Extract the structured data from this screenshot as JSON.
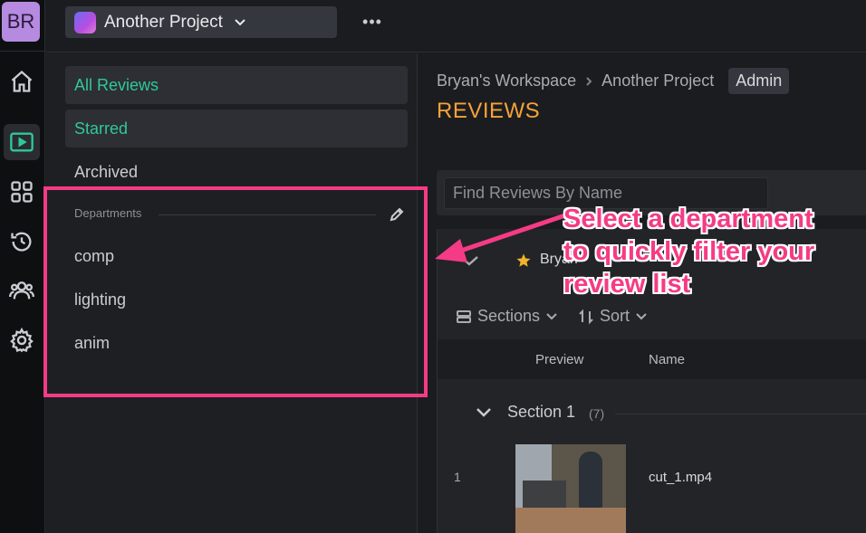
{
  "rail": {
    "avatar_initials": "BR",
    "icons": [
      "home-icon",
      "play-icon",
      "grid-icon",
      "history-icon",
      "people-icon",
      "gear-icon"
    ],
    "accent": "#2fc89a"
  },
  "topbar": {
    "project_name": "Another Project",
    "more_label": "•••"
  },
  "left_panel": {
    "items": [
      {
        "label": "All Reviews"
      },
      {
        "label": "Starred"
      },
      {
        "label": "Archived"
      }
    ],
    "departments_heading": "Departments",
    "departments": [
      "comp",
      "lighting",
      "anim"
    ]
  },
  "main": {
    "breadcrumb": [
      "Bryan's Workspace",
      "Another Project"
    ],
    "role_badge": "Admin",
    "title": "REVIEWS",
    "search_placeholder": "Find Reviews By Name",
    "owner": "Bryan",
    "toolbar": {
      "sections": "Sections",
      "sort": "Sort"
    },
    "table_headers": {
      "preview": "Preview",
      "name": "Name"
    },
    "section": {
      "name": "Section 1",
      "count": "(7)"
    },
    "rows": [
      {
        "index": "1",
        "file": "cut_1.mp4"
      }
    ]
  },
  "annotation": {
    "callout_lines": [
      "Select a department",
      "to quickly filter your",
      "review list"
    ],
    "color": "#f53b86"
  }
}
